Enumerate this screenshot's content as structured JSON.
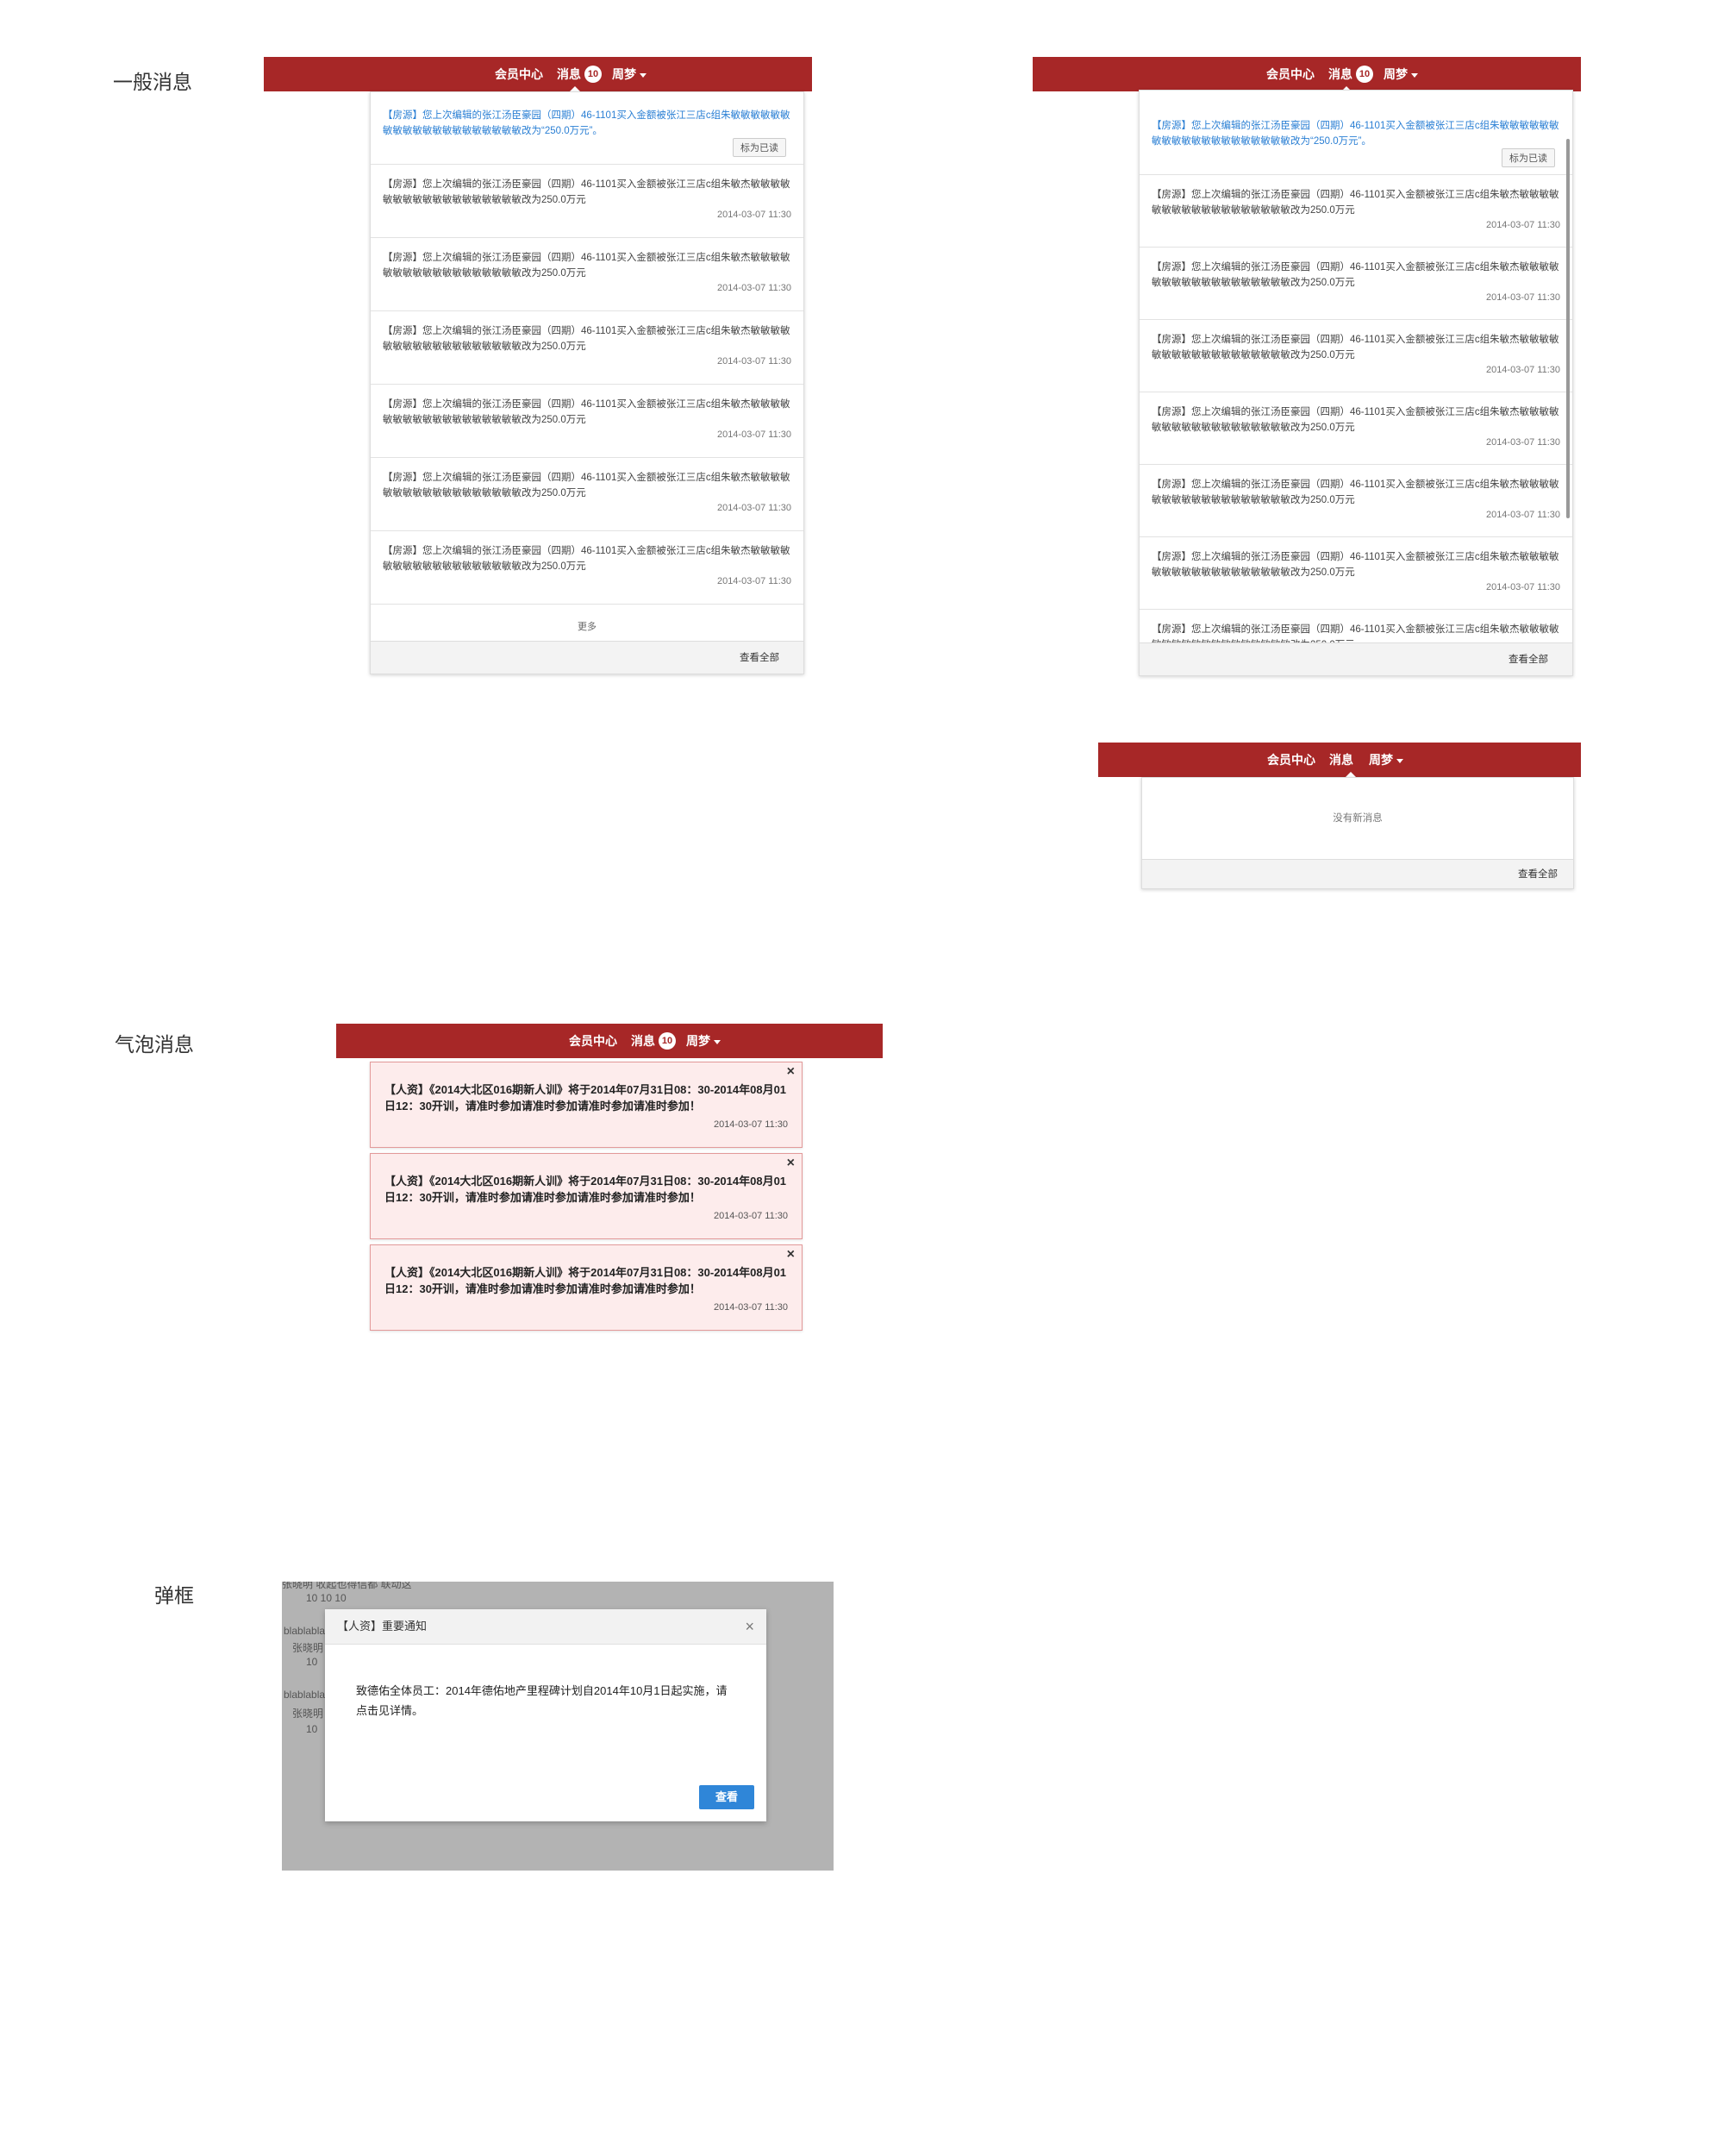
{
  "sections": {
    "general": "一般消息",
    "bubble": "气泡消息",
    "dialog": "弹框"
  },
  "header": {
    "member": "会员中心",
    "messages": "消息",
    "badge": "10",
    "user": "周梦"
  },
  "dropdown": {
    "unread_text": "【房源】您上次编辑的张江汤臣豪园（四期）46-1101买入金额被张江三店c组朱敏敏敏敏敏敏敏敏敏敏敏敏敏敏敏敏敏敏敏敏改为“250.0万元”。",
    "mark_read": "标为已读",
    "item_text": "【房源】您上次编辑的张江汤臣豪园（四期）46-1101买入金额被张江三店c组朱敏杰敏敏敏敏敏敏敏敏敏敏敏敏敏敏敏敏敏敏改为250.0万元",
    "item_time": "2014-03-07  11:30",
    "more": "更多",
    "view_all": "查看全部",
    "empty": "没有新消息"
  },
  "bubble": {
    "text": "【人资】《2014大北区016期新人训》将于2014年07月31日08：30-2014年08月01日12：30开训，请准时参加请准时参加请准时参加请准时参加！",
    "time": "2014-03-07  11:30",
    "close": "×"
  },
  "modal": {
    "title": "【人资】重要通知",
    "close": "×",
    "body": "致德佑全体员工：2014年德佑地产里程碑计划自2014年10月1日起实施，请点击见详情。",
    "button": "查看",
    "bg_line1": "张晓明   收起也得信都  联动这",
    "bg_nums": "10          10          10",
    "bg_name": "blablabla",
    "bg_person": "张晓明",
    "bg_num": "10"
  },
  "colors": {
    "header_red": "#a72727",
    "unread_blue": "#2a7fd4",
    "bubble_bg": "#fdecec",
    "button_blue": "#2f86d8"
  }
}
